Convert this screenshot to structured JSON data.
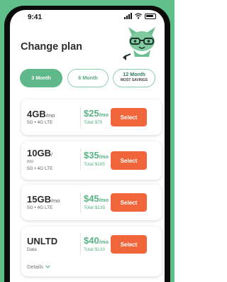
{
  "status_bar": {
    "time": "9:41"
  },
  "page": {
    "title": "Change plan"
  },
  "tabs": [
    {
      "label": "3 Month",
      "active": true
    },
    {
      "label": "6 Month",
      "active": false
    },
    {
      "label": "12 Month",
      "badge": "MOST SAVINGS",
      "active": false
    }
  ],
  "plans": [
    {
      "size": "4GB",
      "size_unit": "/mo",
      "network": "5G • 4G LTE",
      "price": "$25",
      "price_unit": "/mo",
      "total": "Total $75",
      "button": "Select"
    },
    {
      "size": "10GB",
      "size_unit": "/",
      "size_unit_line2": "mo",
      "network": "5G • 4G LTE",
      "price": "$35",
      "price_unit": "/mo",
      "total": "Total $105",
      "button": "Select"
    },
    {
      "size": "15GB",
      "size_unit": "/mo",
      "network": "5G • 4G LTE",
      "price": "$45",
      "price_unit": "/mo",
      "total": "Total $135",
      "button": "Select"
    },
    {
      "size": "UNLTD",
      "network": "Data",
      "price": "$40",
      "price_unit": "/mo",
      "total": "Total $120",
      "button": "Select",
      "details": "Details"
    }
  ],
  "colors": {
    "brand_green": "#5fb88a",
    "price_green": "#57b383",
    "cta_orange": "#f0663a"
  },
  "icons": {
    "mascot": "mint-fox-mascot-icon",
    "details_toggle": "chevron-down-icon"
  }
}
